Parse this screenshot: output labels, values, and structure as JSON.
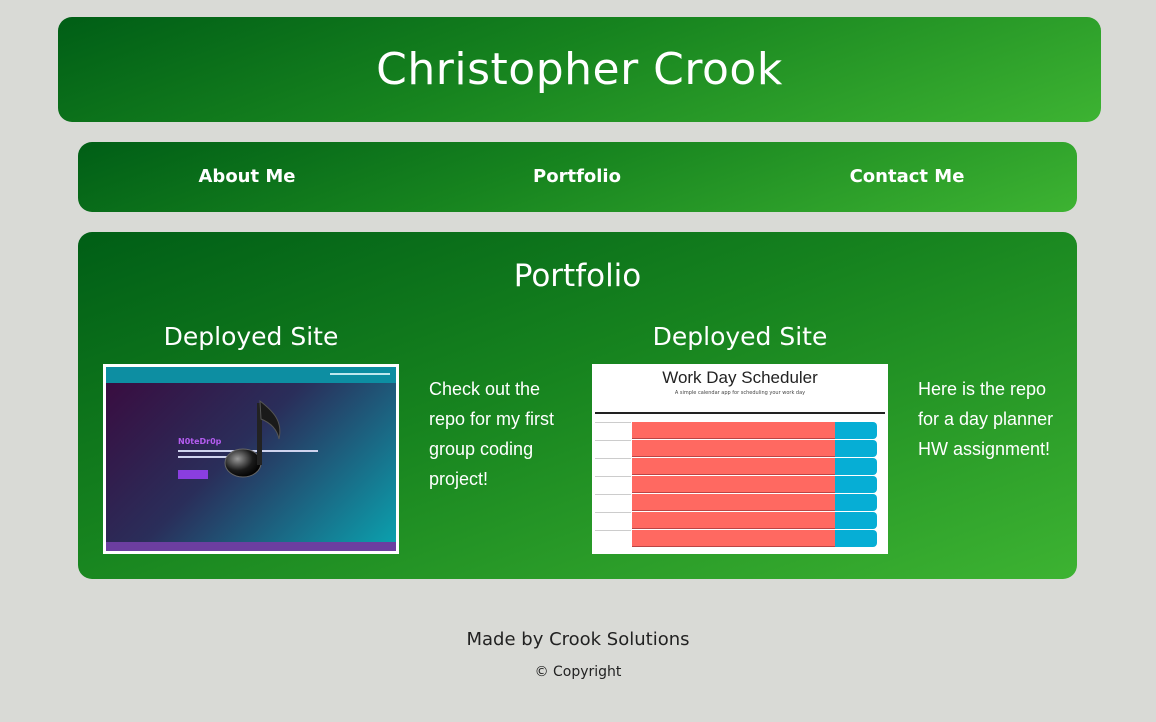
{
  "header": {
    "title": "Christopher Crook"
  },
  "nav": {
    "items": [
      {
        "label": "About Me"
      },
      {
        "label": "Portfolio"
      },
      {
        "label": "Contact Me"
      }
    ]
  },
  "portfolio": {
    "heading": "Portfolio",
    "items": [
      {
        "title": "Deployed Site",
        "description": "Check out the repo for my first group coding project!",
        "thumbnail": {
          "app_name": "N0teDr0p",
          "icon": "music-note-icon"
        }
      },
      {
        "title": "Deployed Site",
        "description": "Here is the repo for a day planner HW assignment!",
        "thumbnail": {
          "app_name": "Work Day Scheduler",
          "subtitle": "A simple calendar app for scheduling your work day"
        }
      }
    ]
  },
  "footer": {
    "made_by": "Made by Crook Solutions",
    "copyright": "© Copyright"
  },
  "colors": {
    "background": "#d9dad6",
    "green_dark": "#005e16",
    "green_light": "#3db332",
    "text": "#ffffff"
  }
}
